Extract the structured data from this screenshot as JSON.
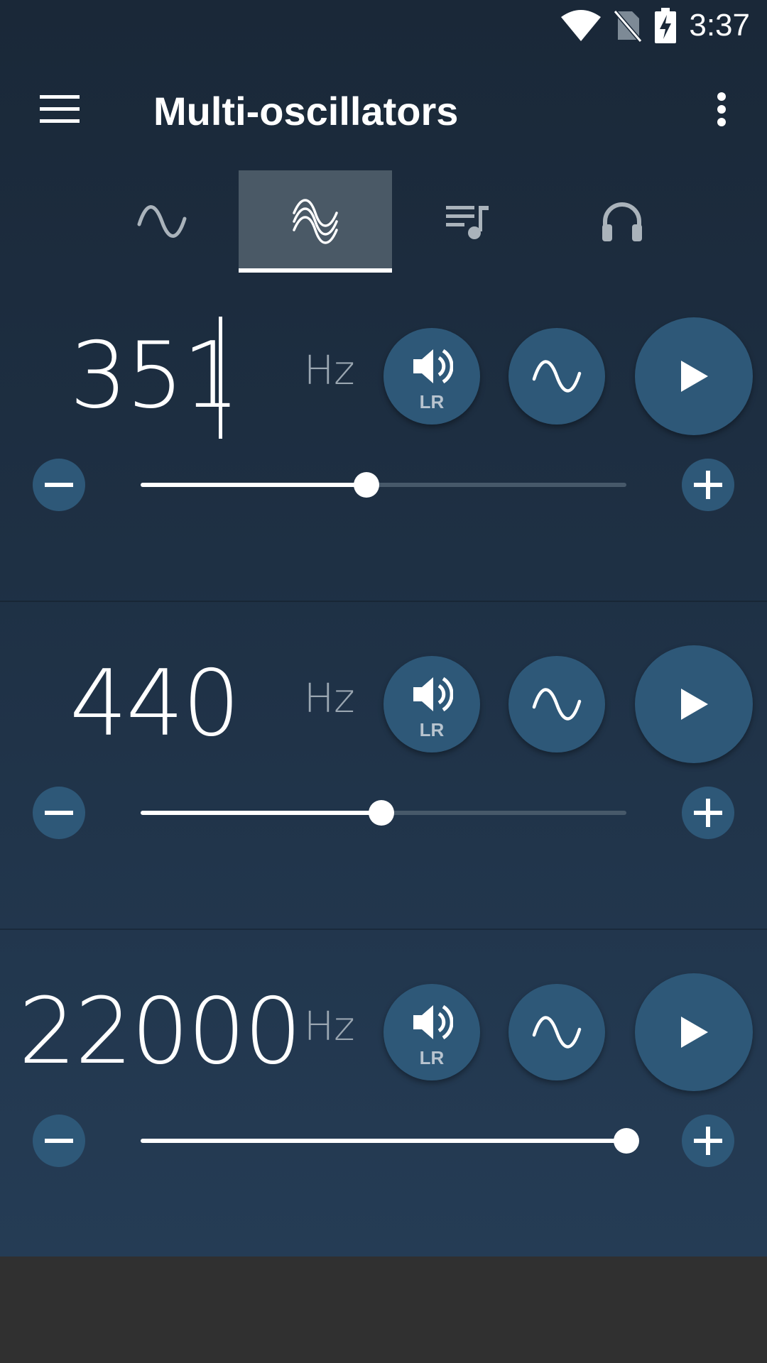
{
  "status_bar": {
    "time": "3:37",
    "icons": [
      "wifi-icon",
      "no-sim-icon",
      "battery-charging-icon"
    ]
  },
  "app_bar": {
    "title": "Multi-oscillators",
    "menu_icon": "menu-icon",
    "overflow_icon": "more-vert-icon"
  },
  "tabs": [
    {
      "icon": "sine-wave-icon",
      "active": false
    },
    {
      "icon": "multi-wave-icon",
      "active": true
    },
    {
      "icon": "playlist-music-icon",
      "active": false
    },
    {
      "icon": "headphones-icon",
      "active": false
    },
    {
      "icon": "sweep-wave-icon",
      "active": false
    }
  ],
  "oscillators": [
    {
      "frequency": "351",
      "unit": "Hz",
      "channel_label": "LR",
      "slider_value": 0.465,
      "editing": true
    },
    {
      "frequency": "440",
      "unit": "Hz",
      "channel_label": "LR",
      "slider_value": 0.495,
      "editing": false
    },
    {
      "frequency": "22000",
      "unit": "Hz",
      "channel_label": "LR",
      "slider_value": 1.0,
      "editing": false
    }
  ],
  "colors": {
    "background_top": "#1a2838",
    "background_bottom": "#253c55",
    "button": "#2e5878",
    "active_tab": "#4a5966",
    "slider_track": "#47596a",
    "accent": "#ffffff"
  }
}
